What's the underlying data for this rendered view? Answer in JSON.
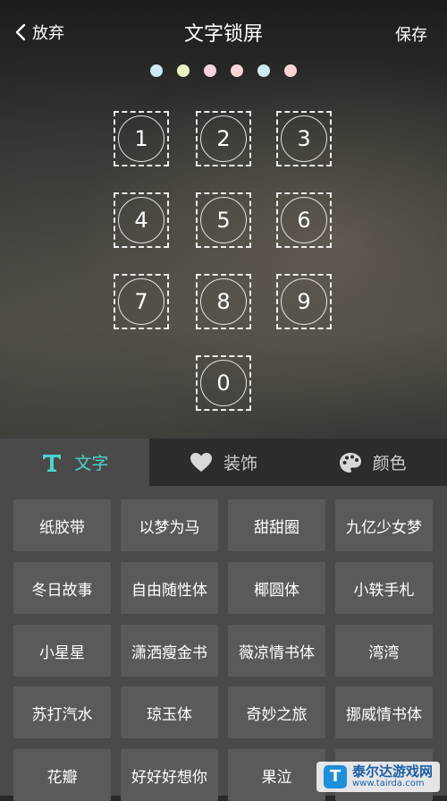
{
  "header": {
    "back_label": "放弃",
    "title": "文字锁屏",
    "save_label": "保存"
  },
  "indicator_dots": [
    "#cde9f3",
    "#e9f0c2",
    "#f4d3da",
    "#f7d5d5",
    "#cde9f3",
    "#f7d5d5"
  ],
  "keypad": [
    "1",
    "2",
    "3",
    "4",
    "5",
    "6",
    "7",
    "8",
    "9",
    "0"
  ],
  "tabs": [
    {
      "label": "文字",
      "icon": "text-t-icon",
      "active": true
    },
    {
      "label": "装饰",
      "icon": "heart-icon",
      "active": false
    },
    {
      "label": "颜色",
      "icon": "palette-icon",
      "active": false
    }
  ],
  "fonts": [
    "纸胶带",
    "以梦为马",
    "甜甜圈",
    "九亿少女梦",
    "冬日故事",
    "自由随性体",
    "椰圆体",
    "小轶手札",
    "小星星",
    "潇洒瘦金书",
    "薇凉情书体",
    "湾湾",
    "苏打汽水",
    "琼玉体",
    "奇妙之旅",
    "挪威情书体",
    "花瓣",
    "好好好想你",
    "果泣",
    ""
  ],
  "watermark": {
    "title": "泰尔达游戏网",
    "url": "www.tairda.com",
    "logo_letter": "T"
  },
  "colors": {
    "accent": "#4fd3cf"
  }
}
